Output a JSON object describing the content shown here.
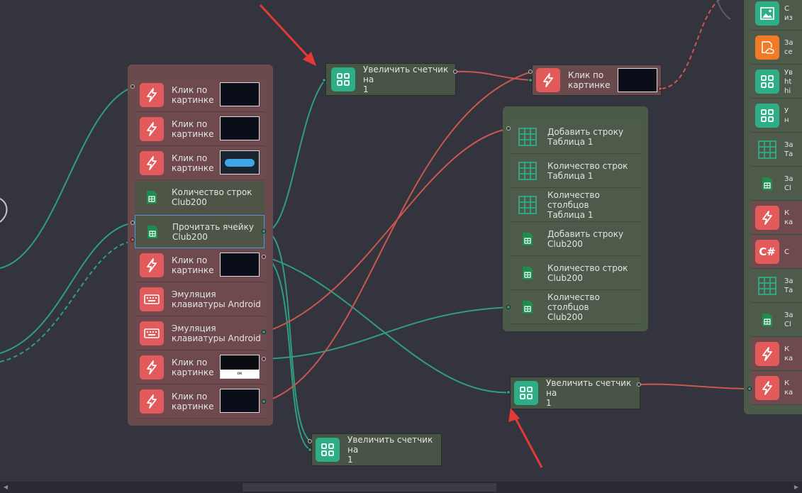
{
  "canvas": {
    "background": "#34343e"
  },
  "nodes": {
    "counter_top": {
      "label": "Увеличить счетчик на\n1",
      "icon": "counter-icon"
    },
    "click_top": {
      "label": "Клик по\nкартинке",
      "icon": "lightning-icon"
    },
    "counter_bottom_left": {
      "label": "Увеличить счетчик на\n1",
      "icon": "counter-icon"
    },
    "counter_bottom_right": {
      "label": "Увеличить счетчик на\n1",
      "icon": "counter-icon"
    }
  },
  "left_group": {
    "rows": [
      {
        "label": "Клик по\nкартинке",
        "icon": "lightning-icon"
      },
      {
        "label": "Клик по\nкартинке",
        "icon": "lightning-icon"
      },
      {
        "label": "Клик по\nкартинке",
        "icon": "lightning-icon"
      },
      {
        "label": "Количество строк\nClub200",
        "icon": "spreadsheet-icon"
      },
      {
        "label": "Прочитать ячейку\nClub200",
        "icon": "spreadsheet-icon"
      },
      {
        "label": "Клик по\nкартинке",
        "icon": "lightning-icon"
      },
      {
        "label": "Эмуляция\nклавиатуры Android",
        "icon": "keyboard-icon"
      },
      {
        "label": "Эмуляция\nклавиатуры Android",
        "icon": "keyboard-icon"
      },
      {
        "label": "Клик по\nкартинке",
        "icon": "lightning-icon"
      },
      {
        "label": "Клик по\nкартинке",
        "icon": "lightning-icon"
      }
    ],
    "thumb_texts": {
      "ok": "ок"
    }
  },
  "middle_group": {
    "rows": [
      {
        "label": "Добавить строку\nТаблица 1",
        "icon": "table-icon"
      },
      {
        "label": "Количество строк\nТаблица 1",
        "icon": "table-icon"
      },
      {
        "label": "Количество столбцов\nТаблица 1",
        "icon": "table-icon"
      },
      {
        "label": "Добавить строку\nClub200",
        "icon": "spreadsheet-icon"
      },
      {
        "label": "Количество строк\nClub200",
        "icon": "spreadsheet-icon"
      },
      {
        "label": "Количество столбцов\nClub200",
        "icon": "spreadsheet-icon"
      }
    ]
  },
  "right_group": {
    "rows": [
      {
        "label": "С\nиз",
        "icon": "image-icon"
      },
      {
        "label": "За\nсе",
        "icon": "cloud-doc-icon"
      },
      {
        "label": "Ув\nht\nhi",
        "icon": "counter-icon"
      },
      {
        "label": "У\nн",
        "icon": "counter-icon"
      },
      {
        "label": "За\nТа",
        "icon": "table-icon"
      },
      {
        "label": "За\nCl",
        "icon": "spreadsheet-icon"
      },
      {
        "label": "К\nка",
        "icon": "lightning-icon"
      },
      {
        "label": "С",
        "icon": "csharp-icon"
      },
      {
        "label": "За\nТа",
        "icon": "table-icon"
      },
      {
        "label": "За\nCl",
        "icon": "spreadsheet-icon"
      },
      {
        "label": "К\nка",
        "icon": "lightning-icon"
      },
      {
        "label": "К\nка",
        "icon": "lightning-icon"
      }
    ],
    "csharp_text": "C#"
  },
  "colors": {
    "green_wire": "#2e9e7e",
    "red_wire": "#c9574f",
    "annotation_arrow": "#e53935"
  }
}
